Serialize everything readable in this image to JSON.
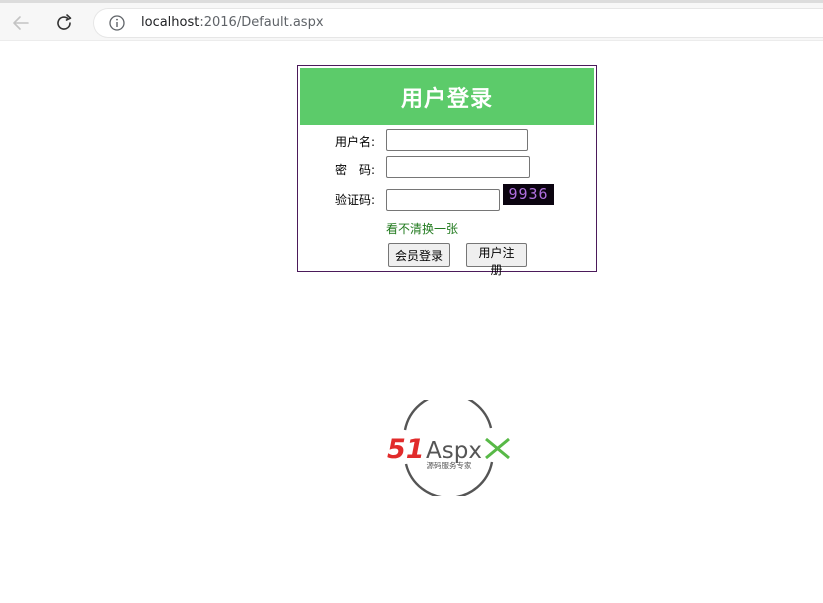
{
  "browser": {
    "url_host": "localhost",
    "url_rest": ":2016/Default.aspx"
  },
  "login": {
    "title": "用户登录",
    "username_label": "用户名:",
    "password_label": "密　码:",
    "captcha_label": "验证码:",
    "captcha_text": "9936",
    "refresh_text": "看不清换一张",
    "login_button": "会员登录",
    "register_button": "用户注册",
    "username_value": "",
    "password_value": "",
    "captcha_value": ""
  },
  "logo": {
    "brand": "51Aspx",
    "tagline": "源码服务专家",
    "colors": {
      "red": "#e12b2b",
      "green": "#58b947",
      "gray": "#555555"
    }
  },
  "colors": {
    "header_green": "#5ccb6a",
    "panel_border": "#4b1a5a",
    "link_green": "#217a1e"
  }
}
